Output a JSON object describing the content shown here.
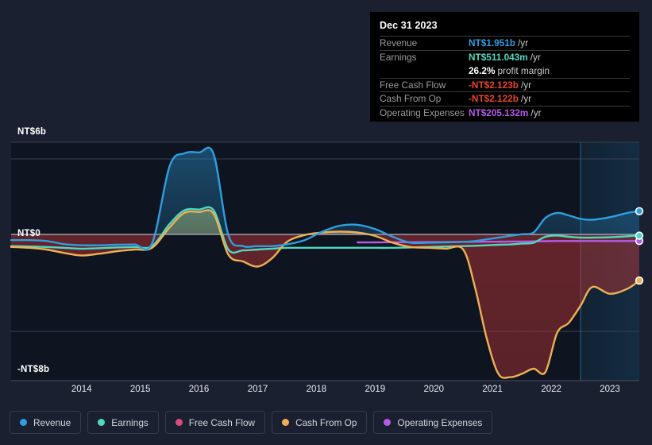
{
  "tooltip": {
    "date": "Dec 31 2023",
    "rows": [
      {
        "label": "Revenue",
        "value": "NT$1.951b",
        "unit": "/yr",
        "color": "#2f9ee0"
      },
      {
        "label": "Earnings",
        "value": "NT$511.043m",
        "unit": "/yr",
        "color": "#4fd8c0"
      },
      {
        "label": "",
        "value": "26.2%",
        "unit": "profit margin",
        "color": "#ffffff"
      },
      {
        "label": "Free Cash Flow",
        "value": "-NT$2.123b",
        "unit": "/yr",
        "color": "#e8432f"
      },
      {
        "label": "Cash From Op",
        "value": "-NT$2.122b",
        "unit": "/yr",
        "color": "#e8432f"
      },
      {
        "label": "Operating Expenses",
        "value": "NT$205.132m",
        "unit": "/yr",
        "color": "#b65ae8"
      }
    ]
  },
  "axes": {
    "y_top_label": "NT$6b",
    "y_zero_label": "NT$0",
    "y_bottom_label": "-NT$8b",
    "x_ticks": [
      "2014",
      "2015",
      "2016",
      "2017",
      "2018",
      "2019",
      "2020",
      "2021",
      "2022",
      "2023"
    ]
  },
  "legend": {
    "items": [
      {
        "label": "Revenue",
        "color": "#2f9ee0"
      },
      {
        "label": "Earnings",
        "color": "#4fd8c0"
      },
      {
        "label": "Free Cash Flow",
        "color": "#d94a7e"
      },
      {
        "label": "Cash From Op",
        "color": "#eeb053"
      },
      {
        "label": "Operating Expenses",
        "color": "#b65ae8"
      }
    ]
  },
  "chart_data": {
    "type": "area",
    "title": "",
    "xlabel": "",
    "ylabel": "",
    "ylim": [
      -8,
      6
    ],
    "ytick_values": [
      6,
      0,
      -8
    ],
    "grid": true,
    "legend_position": "bottom",
    "currency": "NT$",
    "unit": "billions",
    "forecast_start_x": 2023.0,
    "x": [
      2013.3,
      2013.6,
      2013.9,
      2014.2,
      2014.5,
      2014.8,
      2015.1,
      2015.4,
      2015.7,
      2016.0,
      2016.25,
      2016.5,
      2016.75,
      2017.0,
      2017.25,
      2017.5,
      2017.75,
      2018.0,
      2018.3,
      2018.6,
      2018.9,
      2019.2,
      2019.5,
      2019.8,
      2020.1,
      2020.4,
      2020.7,
      2021.0,
      2021.2,
      2021.4,
      2021.6,
      2021.8,
      2022.0,
      2022.2,
      2022.4,
      2022.6,
      2022.8,
      2023.0,
      2023.2,
      2023.5,
      2023.8,
      2024.0
    ],
    "series": [
      {
        "name": "Revenue",
        "color": "#2f9ee0",
        "values": [
          0.25,
          0.25,
          0.2,
          0.02,
          -0.05,
          -0.05,
          -0.02,
          0.0,
          0.05,
          4.6,
          5.35,
          5.4,
          5.3,
          0.55,
          -0.1,
          -0.1,
          -0.1,
          0.0,
          0.25,
          0.75,
          1.1,
          1.15,
          0.9,
          0.45,
          0.1,
          0.1,
          0.12,
          0.15,
          0.2,
          0.3,
          0.4,
          0.5,
          0.6,
          0.7,
          1.55,
          1.85,
          1.7,
          1.5,
          1.45,
          1.6,
          1.85,
          1.951
        ]
      },
      {
        "name": "Earnings",
        "color": "#4fd8c0",
        "values": [
          -0.1,
          -0.12,
          -0.15,
          -0.2,
          -0.25,
          -0.22,
          -0.18,
          -0.15,
          -0.1,
          1.2,
          2.0,
          2.05,
          2.0,
          -0.3,
          -0.35,
          -0.3,
          -0.25,
          -0.2,
          -0.2,
          -0.2,
          -0.2,
          -0.2,
          -0.2,
          -0.2,
          -0.18,
          -0.15,
          -0.12,
          -0.1,
          -0.08,
          -0.05,
          -0.02,
          0.0,
          0.05,
          0.1,
          0.45,
          0.52,
          0.45,
          0.4,
          0.4,
          0.42,
          0.48,
          0.511
        ]
      },
      {
        "name": "Free Cash Flow",
        "color": "#d94a7e",
        "values": [
          -0.15,
          -0.2,
          -0.3,
          -0.5,
          -0.65,
          -0.55,
          -0.4,
          -0.3,
          -0.2,
          1.0,
          1.85,
          1.9,
          1.8,
          -0.6,
          -1.0,
          -1.3,
          -0.8,
          0.15,
          0.55,
          0.7,
          0.75,
          0.7,
          0.5,
          0.1,
          -0.15,
          -0.2,
          -0.25,
          -0.3,
          -2.5,
          -5.5,
          -7.6,
          -7.8,
          -7.6,
          -7.3,
          -7.5,
          -5.2,
          -4.6,
          -3.6,
          -2.5,
          -2.9,
          -2.6,
          -2.123
        ]
      },
      {
        "name": "Cash From Op",
        "color": "#eeb053",
        "values": [
          -0.15,
          -0.2,
          -0.3,
          -0.5,
          -0.65,
          -0.55,
          -0.4,
          -0.3,
          -0.2,
          1.0,
          1.85,
          1.9,
          1.8,
          -0.6,
          -1.0,
          -1.3,
          -0.8,
          0.15,
          0.55,
          0.7,
          0.75,
          0.7,
          0.5,
          0.1,
          -0.15,
          -0.2,
          -0.25,
          -0.3,
          -2.5,
          -5.5,
          -7.6,
          -7.8,
          -7.6,
          -7.3,
          -7.5,
          -5.2,
          -4.6,
          -3.6,
          -2.5,
          -2.9,
          -2.6,
          -2.122
        ]
      },
      {
        "name": "Operating Expenses",
        "color": "#b65ae8",
        "values": [
          null,
          null,
          null,
          null,
          null,
          null,
          null,
          null,
          null,
          null,
          null,
          null,
          null,
          null,
          null,
          null,
          null,
          null,
          null,
          null,
          null,
          0.12,
          0.12,
          0.13,
          0.13,
          0.14,
          0.14,
          0.15,
          0.15,
          0.16,
          0.16,
          0.17,
          0.17,
          0.18,
          0.19,
          0.2,
          0.2,
          0.2,
          0.2,
          0.2,
          0.2,
          0.205
        ]
      }
    ]
  }
}
